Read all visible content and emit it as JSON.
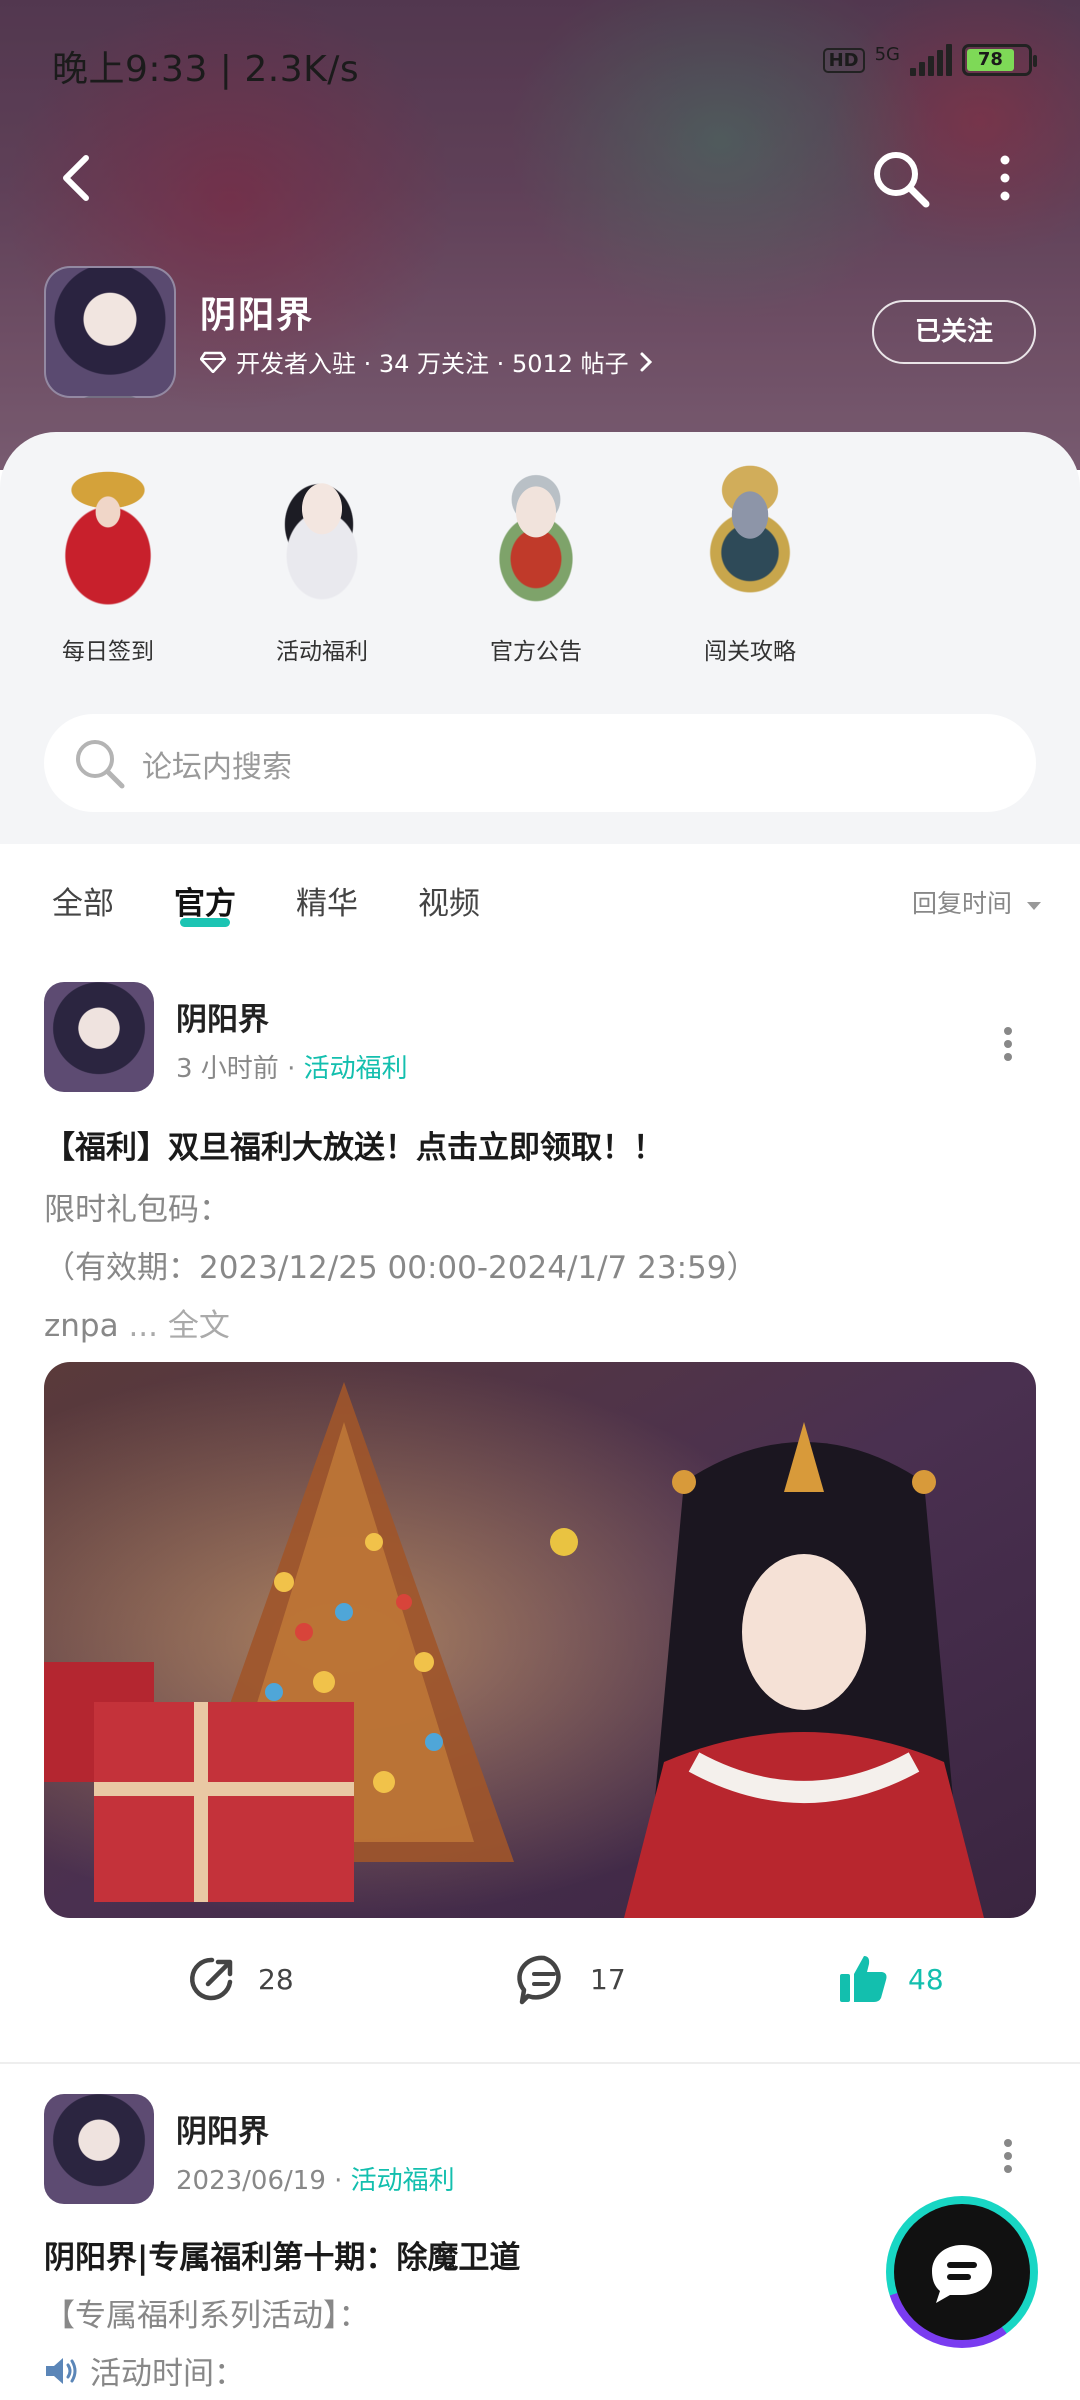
{
  "status_bar": {
    "time_speed": "晚上9:33 | 2.3K/s",
    "hd": "HD",
    "network": "5G",
    "battery": "78"
  },
  "forum": {
    "name": "阴阳界",
    "meta": "开发者入驻 · 34 万关注 · 5012 帖子",
    "follow_label": "已关注"
  },
  "categories": [
    {
      "label": "每日签到"
    },
    {
      "label": "活动福利"
    },
    {
      "label": "官方公告"
    },
    {
      "label": "闯关攻略"
    }
  ],
  "search": {
    "placeholder": "论坛内搜索"
  },
  "tabs": [
    {
      "label": "全部"
    },
    {
      "label": "官方"
    },
    {
      "label": "精华"
    },
    {
      "label": "视频"
    }
  ],
  "sort_label": "回复时间",
  "posts": [
    {
      "author": "阴阳界",
      "time": "3 小时前",
      "tag": "活动福利",
      "title": "【福利】双旦福利大放送！点击立即领取！！",
      "line1": "限时礼包码：",
      "line2": "（有效期：2023/12/25 00:00-2024/1/7 23:59）",
      "line3": "znpa",
      "ellipsis": "...",
      "full_text": "全文",
      "shares": "28",
      "comments": "17",
      "likes": "48"
    },
    {
      "author": "阴阳界",
      "time": "2023/06/19",
      "tag": "活动福利",
      "title": "阴阳界|专属福利第十期：除魔卫道",
      "line1": "【专属福利系列活动】：",
      "line2": "活动时间："
    }
  ]
}
